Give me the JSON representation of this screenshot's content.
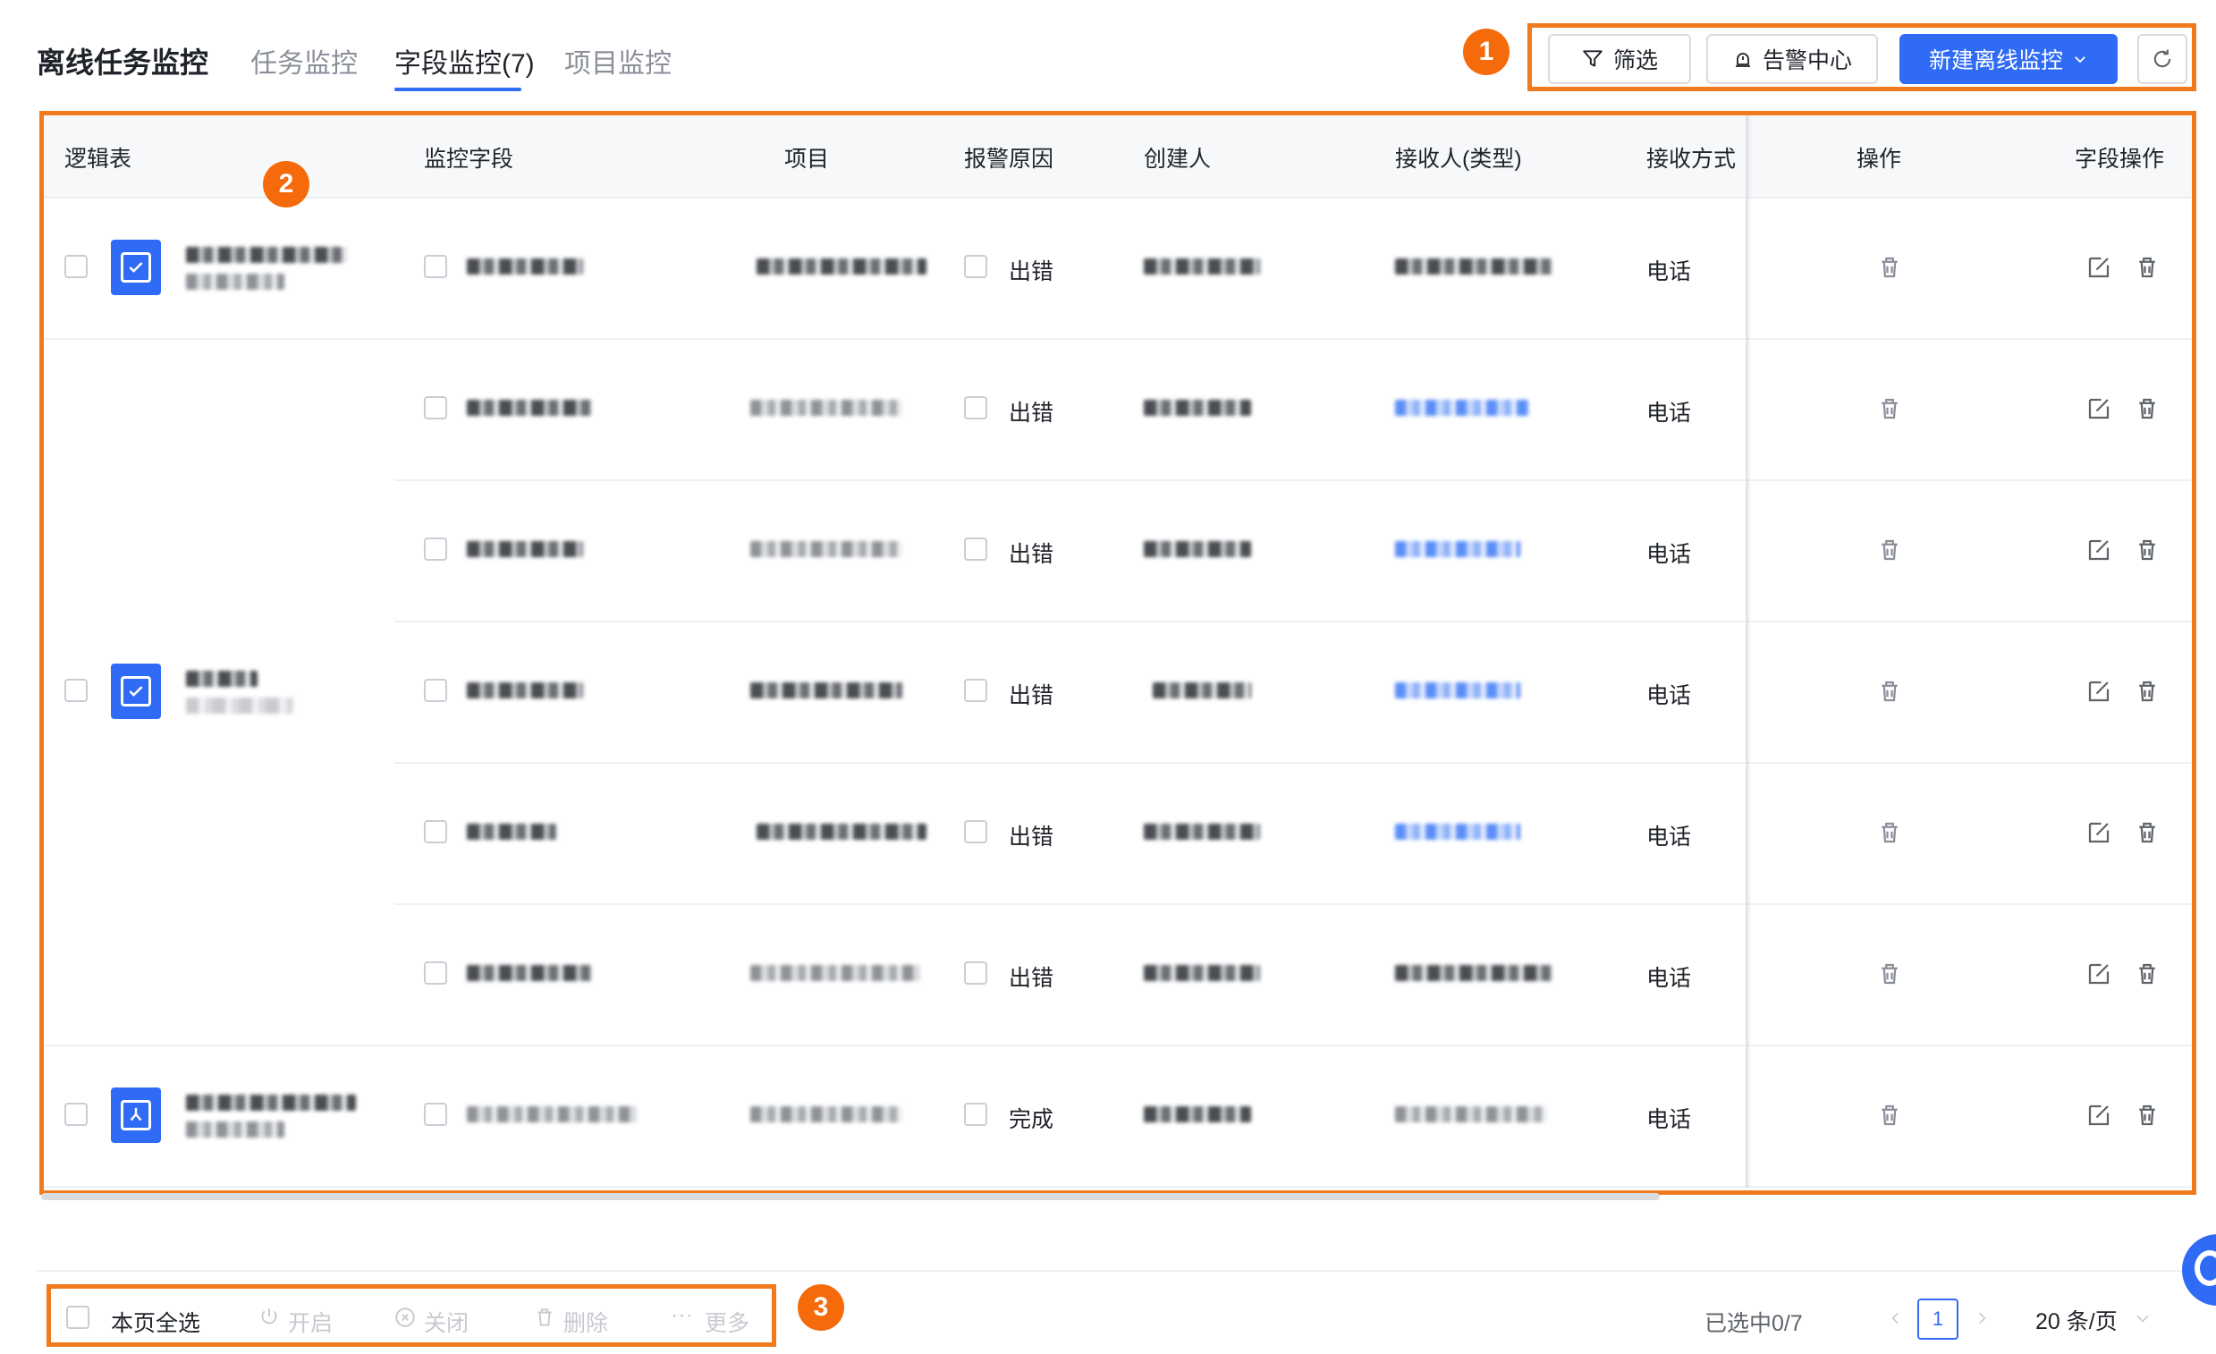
{
  "tabs": {
    "title": "离线任务监控",
    "task": "任务监控",
    "field": "字段监控(7)",
    "project": "项目监控"
  },
  "toolbar": {
    "filter": "筛选",
    "alert_center": "告警中心",
    "new_monitor": "新建离线监控"
  },
  "callouts": {
    "one": "1",
    "two": "2",
    "three": "3"
  },
  "table": {
    "headers": {
      "logic_table": "逻辑表",
      "monitor_field": "监控字段",
      "project": "项目",
      "reason": "报警原因",
      "creator": "创建人",
      "receiver": "接收人(类型)",
      "method": "接收方式",
      "operation": "操作",
      "field_operation": "字段操作"
    },
    "rows": [
      {
        "reason": "出错",
        "method": "电话"
      },
      {
        "reason": "出错",
        "method": "电话"
      },
      {
        "reason": "出错",
        "method": "电话"
      },
      {
        "reason": "出错",
        "method": "电话"
      },
      {
        "reason": "出错",
        "method": "电话"
      },
      {
        "reason": "出错",
        "method": "电话"
      },
      {
        "reason": "完成",
        "method": "电话"
      }
    ]
  },
  "footer": {
    "select_all": "本页全选",
    "enable": "开启",
    "disable": "关闭",
    "delete": "删除",
    "more": "更多",
    "selected": "已选中0/7",
    "page": "1",
    "page_size": "20 条/页"
  },
  "colors": {
    "accent": "#2f6bf5",
    "callout": "#f56a0a"
  }
}
